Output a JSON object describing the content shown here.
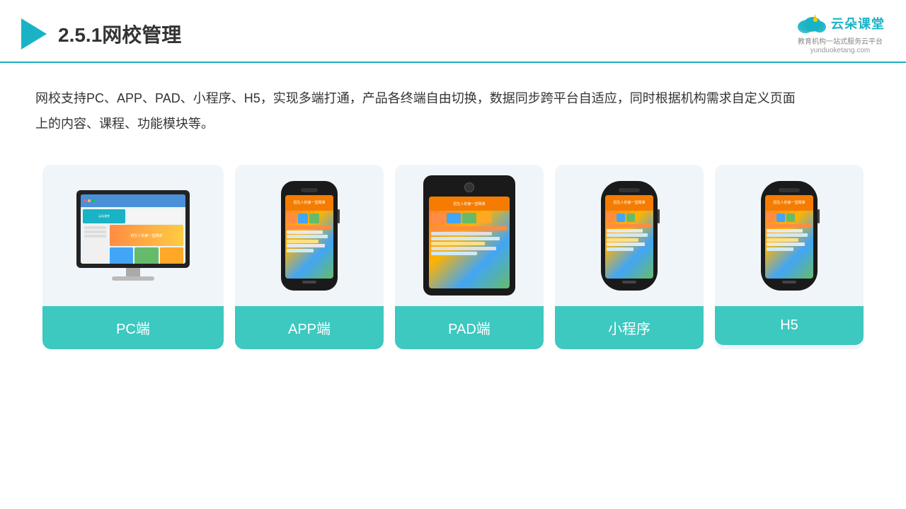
{
  "header": {
    "title": "2.5.1网校管理",
    "logo": {
      "name": "云朵课堂",
      "url": "yunduoketang.com",
      "tagline": "教育机构一站式服务云平台"
    }
  },
  "description": {
    "text": "网校支持PC、APP、PAD、小程序、H5，实现多端打通，产品各终端自由切换，数据同步跨平台自适应，同时根据机构需求自定义页面上的内容、课程、功能模块等。"
  },
  "cards": [
    {
      "id": "pc",
      "label": "PC端",
      "type": "pc"
    },
    {
      "id": "app",
      "label": "APP端",
      "type": "phone"
    },
    {
      "id": "pad",
      "label": "PAD端",
      "type": "tablet"
    },
    {
      "id": "mini",
      "label": "小程序",
      "type": "phone"
    },
    {
      "id": "h5",
      "label": "H5",
      "type": "phone"
    }
  ],
  "colors": {
    "teal": "#3dc8c0",
    "accent": "#1ab3c6",
    "dark": "#333333"
  }
}
